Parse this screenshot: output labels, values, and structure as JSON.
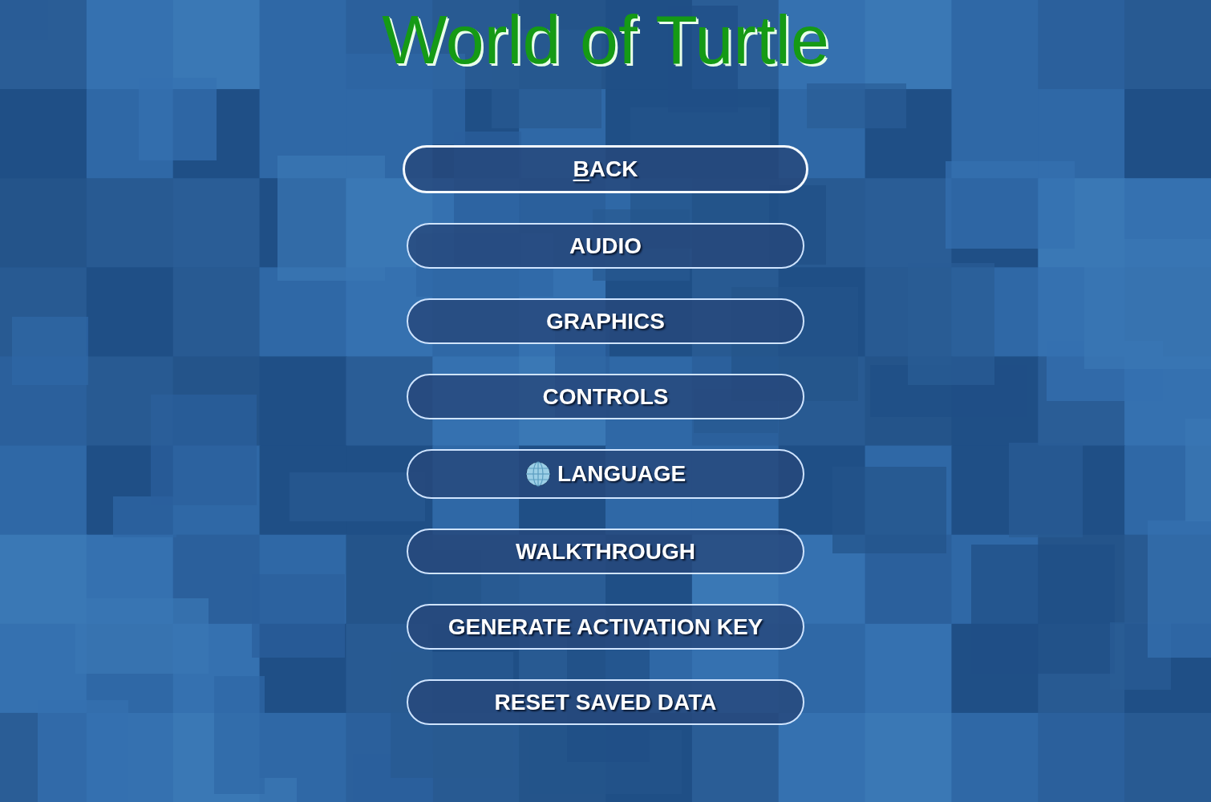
{
  "title": "World of Turtle",
  "menu": [
    {
      "label": "BACK",
      "kind": "plain",
      "selected": true
    },
    {
      "label": "AUDIO",
      "kind": "plain",
      "selected": false
    },
    {
      "label": "GRAPHICS",
      "kind": "plain",
      "selected": false
    },
    {
      "label": "CONTROLS",
      "kind": "plain",
      "selected": false
    },
    {
      "label": "LANGUAGE",
      "kind": "icon",
      "selected": false
    },
    {
      "label": "WALKTHROUGH",
      "kind": "plain",
      "selected": false
    },
    {
      "label": "GENERATE ACTIVATION KEY",
      "kind": "plain",
      "selected": false
    },
    {
      "label": "RESET SAVED DATA",
      "kind": "plain",
      "selected": false
    }
  ]
}
